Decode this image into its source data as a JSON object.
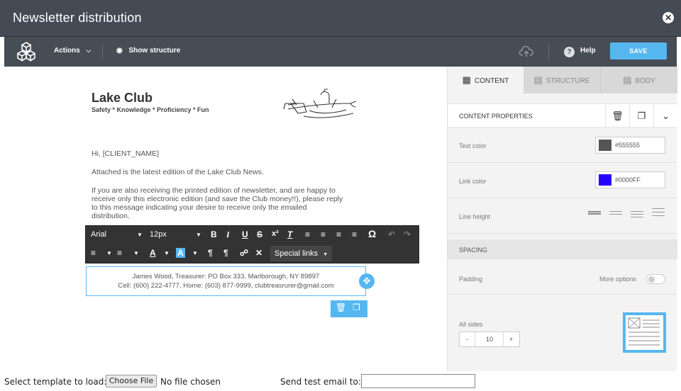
{
  "window": {
    "title": "Newsletter distribution",
    "close_icon": "close-icon"
  },
  "toolbar": {
    "actions_label": "Actions",
    "show_structure_label": "Show structure",
    "help_label": "Help",
    "save_label": "SAVE"
  },
  "email": {
    "club_title": "Lake Club",
    "club_subtitle": "Safety  *  Knowledge  *  Proficiency  *  Fun",
    "greeting": "Hi, [CLIENT_NAME]",
    "para1": "Attached is the latest edition of the Lake Club News.",
    "para2_l1": "If you are also receiving the printed edition of newsletter, and are happy to",
    "para2_l2": "receive only this electronic edition (and save the Club money!!), please reply",
    "para2_l3": "to this message indicating your desire to receive only the emailed",
    "para2_l4": "distribution.",
    "sig_line1": "James Wood, Treasurer:    PO Box 333, Marlborough, NY 89897",
    "sig_line2": "Cell:  (600) 222-4777,  Home:  (603) 877-9999,  clubtreasrurer@gmail.com"
  },
  "editor": {
    "font": "Arial",
    "size": "12px",
    "special_links": "Special links"
  },
  "panel": {
    "tabs": [
      "CONTENT",
      "STRUCTURE",
      "BODY"
    ],
    "header": "CONTENT PROPERTIES",
    "text_color_label": "Text color",
    "text_color_value": "#555555",
    "link_color_label": "Link color",
    "link_color_value": "#0000FF",
    "line_height_label": "Line height",
    "spacing_label": "SPACING",
    "padding_label": "Padding",
    "more_options_label": "More options",
    "all_sides_label": "All sides",
    "stepper_minus": "-",
    "stepper_value": "10",
    "stepper_plus": "+"
  },
  "bottom": {
    "template_label": "Select template to load:",
    "choose_file": "Choose File",
    "no_file": "No file chosen",
    "send_test_label": "Send test email to:"
  },
  "colors": {
    "accent": "#56b7f0",
    "titlebar": "#444b55",
    "text_swatch": "#555555",
    "link_swatch": "#2400ff"
  }
}
